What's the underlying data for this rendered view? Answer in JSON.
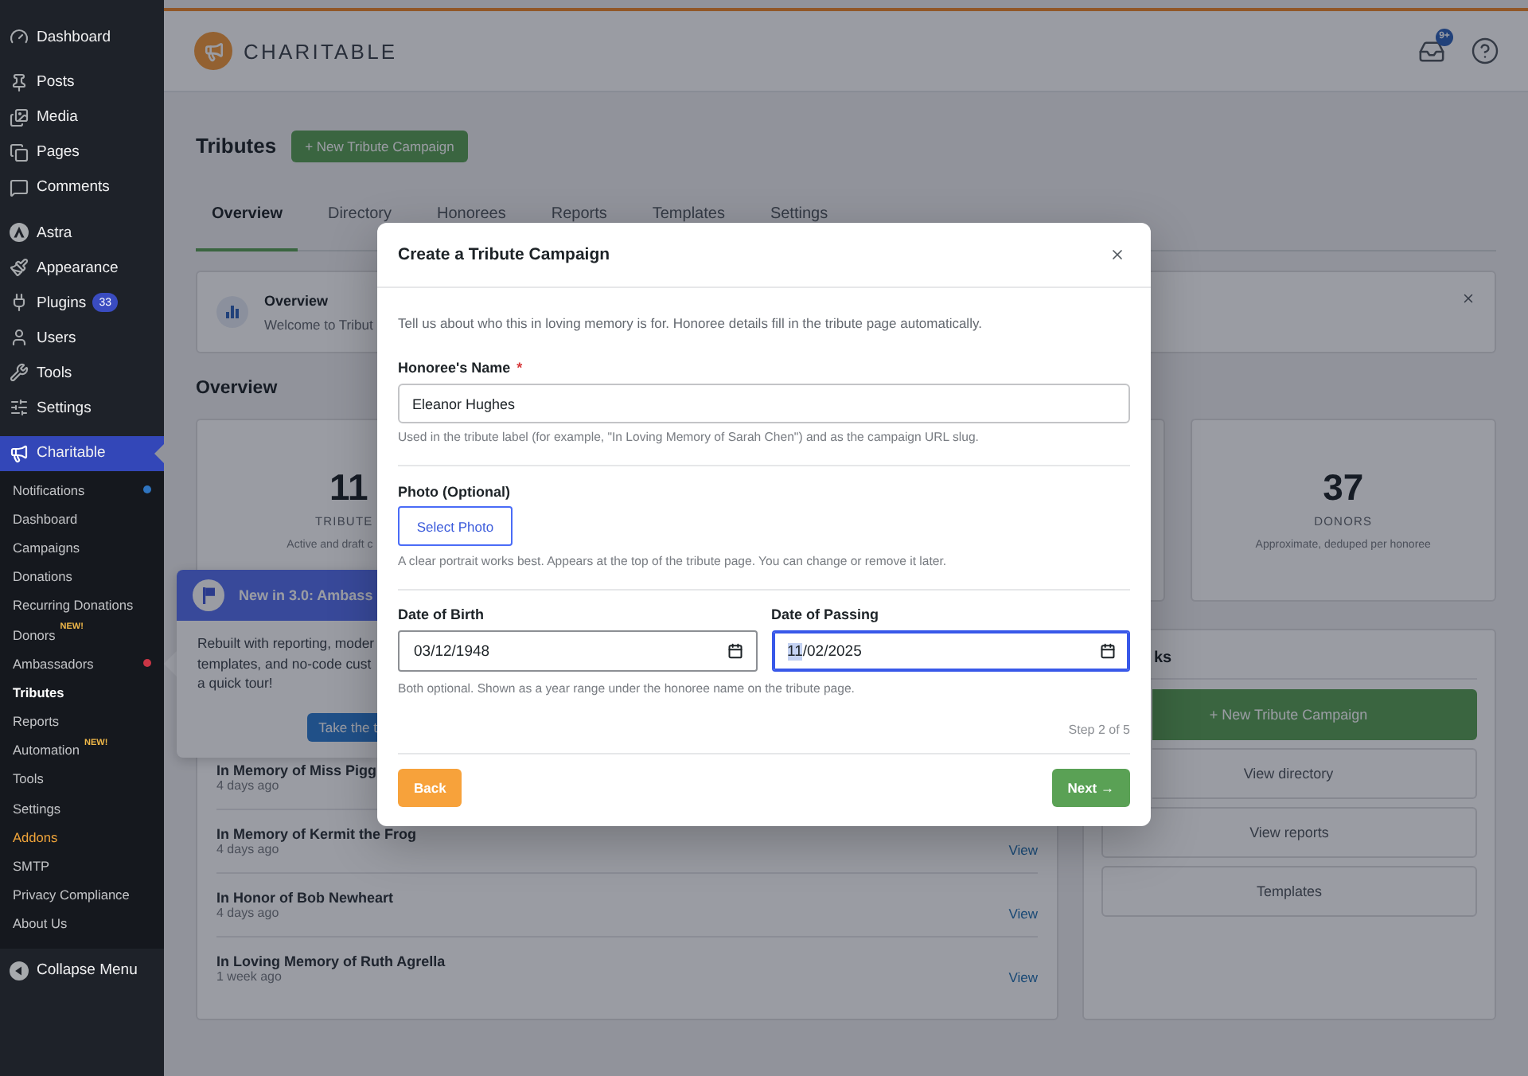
{
  "sidebar": {
    "menu_groups": [
      {
        "items": [
          {
            "label": "Dashboard",
            "selected": false
          }
        ]
      },
      {
        "items": [
          {
            "label": "Posts",
            "selected": false
          },
          {
            "label": "Media",
            "selected": false
          },
          {
            "label": "Pages",
            "selected": false
          },
          {
            "label": "Comments",
            "selected": false
          }
        ]
      },
      {
        "items": [
          {
            "label": "Astra",
            "selected": false
          },
          {
            "label": "Appearance",
            "selected": false
          },
          {
            "label": "Plugins",
            "selected": false,
            "badge": "33"
          },
          {
            "label": "Users",
            "selected": false
          },
          {
            "label": "Tools",
            "selected": false
          },
          {
            "label": "Settings",
            "selected": false
          }
        ]
      },
      {
        "items": [
          {
            "label": "Charitable",
            "selected": true,
            "submenu": [
              {
                "label": "Notifications",
                "selected": false,
                "kind": "link",
                "color": "#2f74c0"
              },
              {
                "label": "Dashboard",
                "selected": false,
                "kind": "link"
              },
              {
                "label": "Campaigns",
                "selected": false,
                "kind": "link"
              },
              {
                "label": "Donations",
                "selected": false,
                "kind": "link"
              },
              {
                "label": "Recurring Donations",
                "selected": false,
                "kind": "link"
              },
              {
                "label": "Donors",
                "selected": false,
                "kind": "link",
                "tag": "NEW!"
              },
              {
                "label": "Ambassadors",
                "selected": false,
                "kind": "link",
                "color": "#c93545"
              },
              {
                "label": "Tributes",
                "selected": true,
                "kind": "link"
              },
              {
                "label": "Reports",
                "selected": false,
                "kind": "link"
              },
              {
                "label": "Automation",
                "selected": false,
                "kind": "link",
                "tag": "NEW!"
              },
              {
                "label": "Tools",
                "selected": false,
                "kind": "link"
              },
              {
                "label": "Settings",
                "selected": false,
                "kind": "link"
              },
              {
                "label": "Addons",
                "selected": false,
                "kind": "upsell"
              },
              {
                "label": "SMTP",
                "selected": false,
                "kind": "link"
              },
              {
                "label": "Privacy Compliance",
                "selected": false,
                "kind": "link"
              },
              {
                "label": "About Us",
                "selected": false,
                "kind": "link"
              }
            ]
          }
        ]
      }
    ],
    "collapse_label": "Collapse Menu"
  },
  "header": {
    "brand": "CHARITABLE",
    "inbox_badge": "9+"
  },
  "page": {
    "title": "Tributes",
    "new_button": "+ New Tribute Campaign",
    "tabs": [
      {
        "label": "Overview",
        "selected": true
      },
      {
        "label": "Directory",
        "selected": false
      },
      {
        "label": "Honorees",
        "selected": false
      },
      {
        "label": "Reports",
        "selected": false
      },
      {
        "label": "Templates",
        "selected": false
      },
      {
        "label": "Settings",
        "selected": false
      }
    ],
    "notice": {
      "title": "Overview",
      "text": "Welcome to Tribut"
    },
    "section_title": "Overview",
    "stats": [
      {
        "value": "11",
        "label": "TRIBUTE",
        "note": "Active and draft c"
      },
      {
        "value": "37",
        "label": "DONORS",
        "note": "Approximate, deduped per honoree"
      }
    ],
    "recent": [
      {
        "title": "In Memory of Miss Pigg",
        "time": "4 days ago"
      },
      {
        "title": "In Memory of Kermit the Frog",
        "time": "4 days ago",
        "action": "View"
      },
      {
        "title": "In Honor of Bob Newheart",
        "time": "4 days ago",
        "action": "View"
      },
      {
        "title": "In Loving Memory of Ruth Agrella",
        "time": "1 week ago",
        "action": "View"
      }
    ],
    "quick_links": {
      "title": "ks",
      "buttons": [
        {
          "label": "+ New Tribute Campaign",
          "kind": "primary"
        },
        {
          "label": "View directory",
          "kind": "secondary"
        },
        {
          "label": "View reports",
          "kind": "secondary"
        },
        {
          "label": "Templates",
          "kind": "secondary"
        }
      ]
    }
  },
  "popover": {
    "title": "New in 3.0: Ambass",
    "lines": [
      "Rebuilt with reporting, moder",
      "templates, and no-code cust",
      "a quick tour!"
    ],
    "button": "Take the t"
  },
  "modal": {
    "title": "Create a Tribute Campaign",
    "intro": "Tell us about who this in loving memory is for. Honoree details fill in the tribute page automatically.",
    "sections": [
      {
        "kind": "text",
        "label": "Honoree's Name",
        "required_mark": "*",
        "value": "Eleanor Hughes",
        "help": "Used in the tribute label (for example, \"In Loving Memory of Sarah Chen\") and as the campaign URL slug."
      },
      {
        "kind": "photo",
        "label": "Photo (Optional)",
        "button": "Select Photo",
        "help": "A clear portrait works best. Appears at the top of the tribute page. You can change or remove it later."
      },
      {
        "kind": "dates",
        "fields": [
          {
            "label": "Date of Birth",
            "focused": false,
            "parts": [
              {
                "text": "03/12/1948",
                "selected": false
              }
            ]
          },
          {
            "label": "Date of Passing",
            "focused": true,
            "parts": [
              {
                "text": "11",
                "selected": true
              },
              {
                "text": "/02/2025",
                "selected": false
              }
            ]
          }
        ],
        "help": "Both optional. Shown as a year range under the honoree name on the tribute page."
      }
    ],
    "step": "Step 2 of 5",
    "back_button": "Back",
    "next_button": "Next →"
  }
}
